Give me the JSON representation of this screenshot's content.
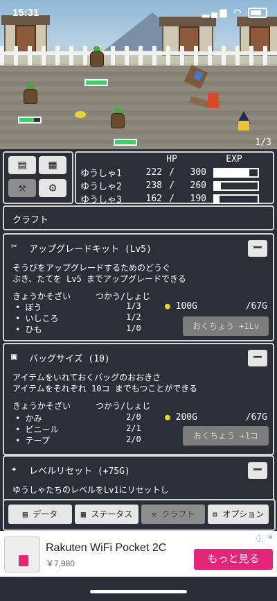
{
  "status_bar": {
    "time": "15:31"
  },
  "scene": {
    "page_counter": "1/3"
  },
  "party": {
    "header_hp": "HP",
    "header_exp": "EXP",
    "members": [
      {
        "name": "ゆうしゃ1",
        "hp": "222",
        "max_hp": "300",
        "exp_fraction": 0.8
      },
      {
        "name": "ゆうしゃ2",
        "hp": "238",
        "max_hp": "260",
        "exp_fraction": 0.15
      },
      {
        "name": "ゆうしゃ3",
        "hp": "162",
        "max_hp": "190",
        "exp_fraction": 0.12
      }
    ],
    "separator": "/"
  },
  "section_title": "クラフト",
  "cards": [
    {
      "title": "アップグレードキット (Lv5)",
      "desc1": "そうびをアップグレードするためのどうぐ",
      "desc2": "ぶき、たてを Lv5 までアップグレードできる",
      "materials_header": "きょうかそざい",
      "needs_header": "つかう/しょじ",
      "materials": [
        {
          "name": "ぼう",
          "needs": "1/3"
        },
        {
          "name": "いしころ",
          "needs": "1/2"
        },
        {
          "name": "ひも",
          "needs": "1/0"
        }
      ],
      "cost": "100G",
      "owned": "/67G",
      "button": "おくちょう +1Lv"
    },
    {
      "title": "バッグサイズ (10)",
      "desc1": "アイテムをいれておくバッグのおおきさ",
      "desc2": "アイテムをそれぞれ 10コ までもつことができる",
      "materials_header": "きょうかそざい",
      "needs_header": "つかう/しょじ",
      "materials": [
        {
          "name": "かみ",
          "needs": "2/0"
        },
        {
          "name": "ビニール",
          "needs": "2/1"
        },
        {
          "name": "テープ",
          "needs": "2/0"
        }
      ],
      "cost": "200G",
      "owned": "/67G",
      "button": "おくちょう +1コ"
    },
    {
      "title": "レベルリセット (+75G)",
      "desc1": "ゆうしゃたちのレベルをLv1にリセットし"
    }
  ],
  "tabs": [
    {
      "label": "データ"
    },
    {
      "label": "ステータス"
    },
    {
      "label": "クラフト"
    },
    {
      "label": "オプション"
    }
  ],
  "ad": {
    "title": "Rakuten WiFi Pocket 2C",
    "price": "￥7,980",
    "cta": "もっと見る"
  }
}
